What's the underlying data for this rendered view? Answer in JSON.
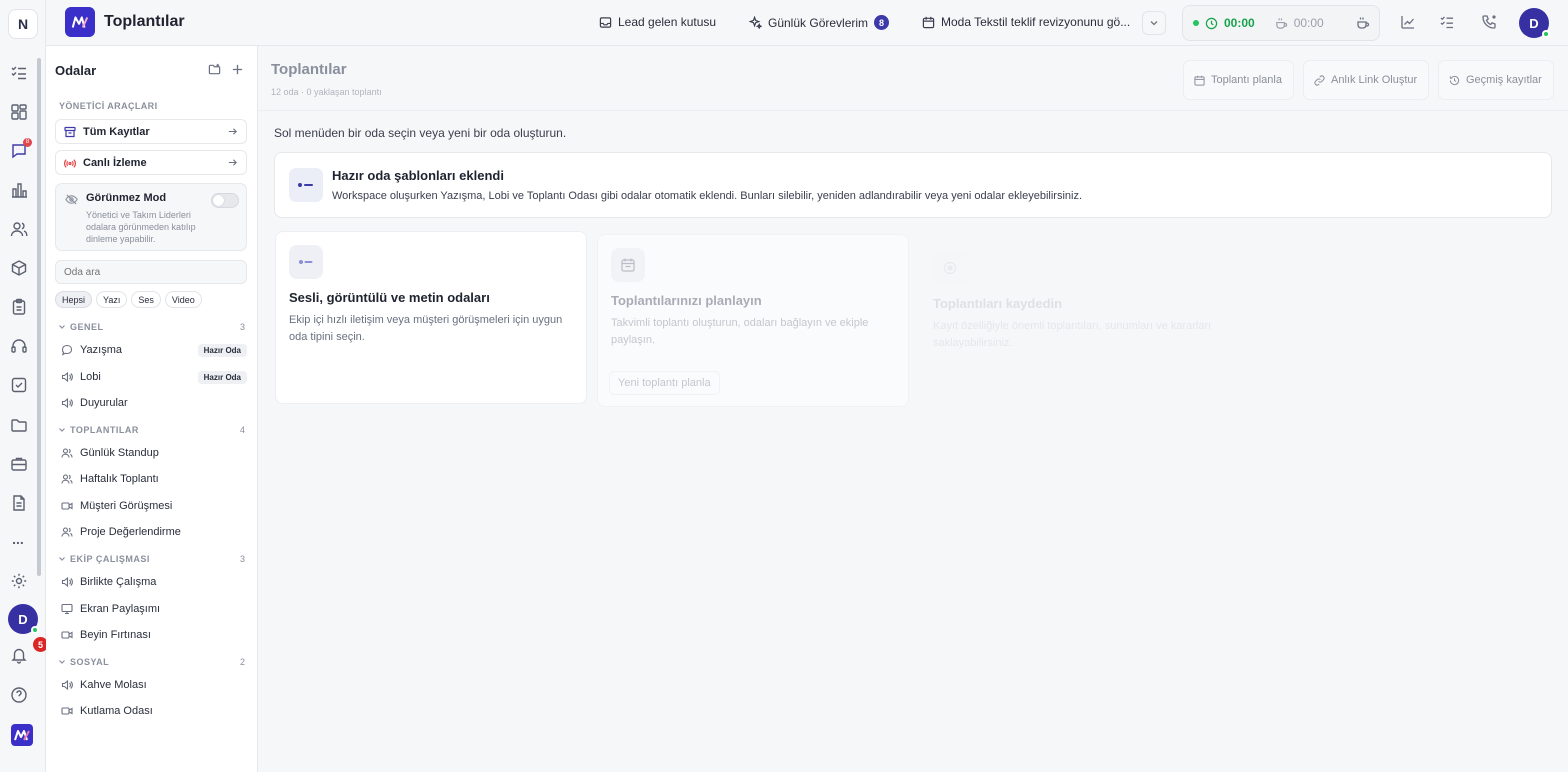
{
  "workspace": {
    "initial": "N"
  },
  "user": {
    "initial": "D"
  },
  "rail": {
    "chat_badge": "8",
    "notifications_count": "5",
    "more_label": "..."
  },
  "header": {
    "title": "Toplantılar",
    "lead_inbox": "Lead gelen kutusu",
    "daily_tasks": "Günlük Görevlerim",
    "daily_tasks_count": "8",
    "current_task": "Moda Tekstil teklif revizyonunu gö...",
    "timer_work": "00:00",
    "timer_break": "00:00"
  },
  "sidebar": {
    "title": "Odalar",
    "admin_tools_label": "YÖNETİCİ ARAÇLARI",
    "all_records": "Tüm Kayıtlar",
    "live_monitoring": "Canlı İzleme",
    "invisible_mode": {
      "title": "Görünmez Mod",
      "description": "Yönetici ve Takım Liderleri odalara görünmeden katılıp dinleme yapabilir."
    },
    "search_placeholder": "Oda ara",
    "filters": [
      "Hepsi",
      "Yazı",
      "Ses",
      "Video"
    ],
    "groups": [
      {
        "label": "GENEL",
        "count": "3",
        "rooms": [
          {
            "name": "Yazışma",
            "tag": "Hazır Oda",
            "icon": "chat-icon"
          },
          {
            "name": "Lobi",
            "tag": "Hazır Oda",
            "icon": "speaker-icon"
          },
          {
            "name": "Duyurular",
            "tag": "",
            "icon": "speaker-icon"
          }
        ]
      },
      {
        "label": "TOPLANTILAR",
        "count": "4",
        "rooms": [
          {
            "name": "Günlük Standup",
            "icon": "people-icon"
          },
          {
            "name": "Haftalık Toplantı",
            "icon": "people-icon"
          },
          {
            "name": "Müşteri Görüşmesi",
            "icon": "video-icon"
          },
          {
            "name": "Proje Değerlendirme",
            "icon": "people-icon"
          }
        ]
      },
      {
        "label": "EKİP ÇALIŞMASI",
        "count": "3",
        "rooms": [
          {
            "name": "Birlikte Çalışma",
            "icon": "speaker-icon"
          },
          {
            "name": "Ekran Paylaşımı",
            "icon": "monitor-icon"
          },
          {
            "name": "Beyin Fırtınası",
            "icon": "video-icon"
          }
        ]
      },
      {
        "label": "SOSYAL",
        "count": "2",
        "rooms": [
          {
            "name": "Kahve Molası",
            "icon": "speaker-icon"
          },
          {
            "name": "Kutlama Odası",
            "icon": "video-icon"
          }
        ]
      }
    ]
  },
  "main": {
    "title": "Toplantılar",
    "subtitle": "12 oda · 0 yaklaşan toplantı",
    "buttons": {
      "schedule": "Toplantı planla",
      "instant_link": "Anlık Link Oluştur",
      "history": "Geçmiş kayıtlar"
    },
    "hint": "Sol menüden bir oda seçin veya yeni bir oda oluşturun.",
    "notice": {
      "title": "Hazır oda şablonları eklendi",
      "description": "Workspace oluşurken Yazışma, Lobi ve Toplantı Odası gibi odalar otomatik eklendi. Bunları silebilir, yeniden adlandırabilir veya yeni odalar ekleyebilirsiniz."
    },
    "features": [
      {
        "title": "Sesli, görüntülü ve metin odaları",
        "description": "Ekip içi hızlı iletişim veya müşteri görüşmeleri için uygun oda tipini seçin."
      },
      {
        "title": "Toplantılarınızı planlayın",
        "description": "Takvimli toplantı oluşturun, odaları bağlayın ve ekiple paylaşın.",
        "button": "Yeni toplantı planla"
      },
      {
        "title": "Toplantıları kaydedin",
        "description": "Kayıt özelliğiyle önemli toplantıları, sunumları ve kararları saklayabilirsiniz."
      }
    ]
  },
  "colors": {
    "accent": "#3b2fc9",
    "avatar": "#3730a3",
    "online": "#22c55e",
    "danger": "#dc2626"
  }
}
